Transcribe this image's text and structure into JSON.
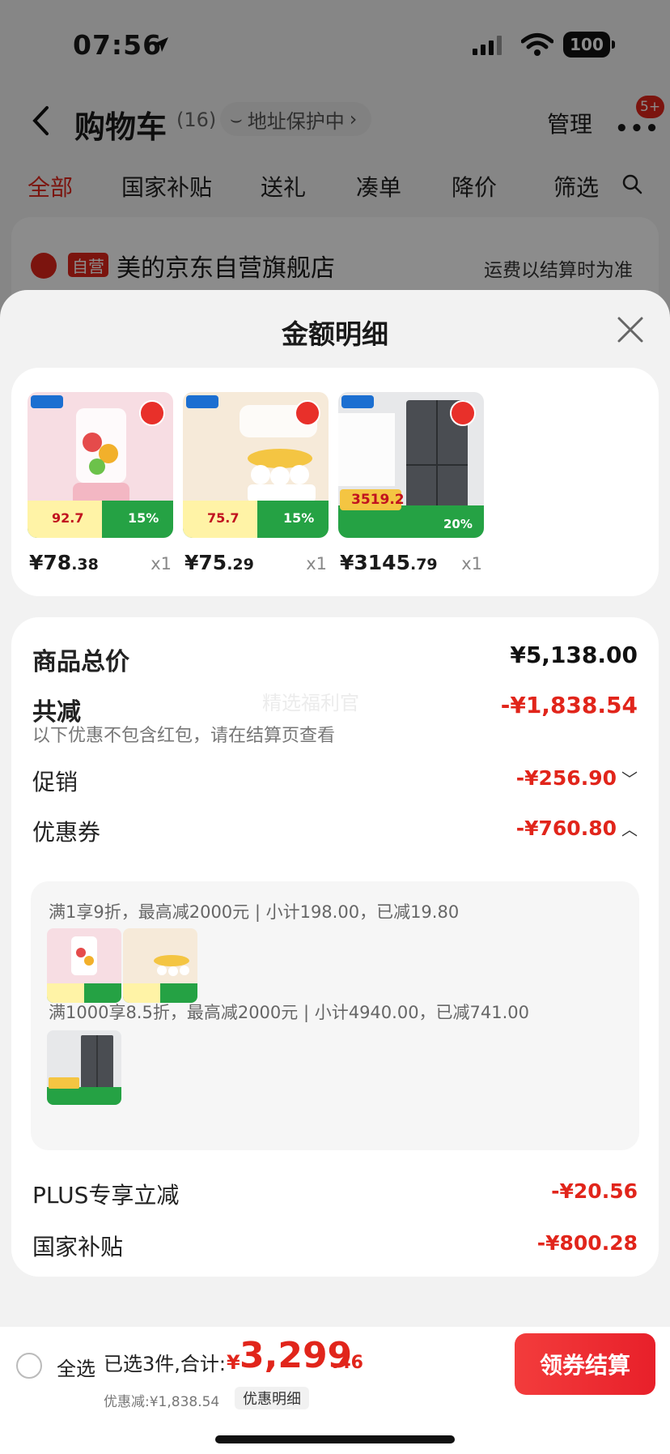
{
  "status_bar": {
    "time": "07:56",
    "battery": "100"
  },
  "nav": {
    "title": "购物车",
    "count": "(16)",
    "address_pill": "地址保护中",
    "manage": "管理",
    "badge": "5+"
  },
  "tabs": [
    "全部",
    "国家补贴",
    "送礼",
    "凑单",
    "降价",
    "筛选"
  ],
  "store": {
    "tag": "自营",
    "name": "美的京东自营旗舰店",
    "note": "运费以结算时为准"
  },
  "sheet": {
    "title": "金额明细",
    "products": [
      {
        "price_int": "¥78",
        "price_dec": ".38",
        "qty": "x1",
        "badge_price": "92.7",
        "subsidy": "15%"
      },
      {
        "price_int": "¥75",
        "price_dec": ".29",
        "qty": "x1",
        "badge_price": "75.7",
        "subsidy": "15%"
      },
      {
        "price_int": "¥3145",
        "price_dec": ".79",
        "qty": "x1",
        "badge_price": "3519.2",
        "subsidy": "20%"
      }
    ],
    "total_label": "商品总价",
    "total_value": "¥5,138.00",
    "reduce_label": "共减",
    "reduce_value": "-¥1,838.54",
    "reduce_note": "以下优惠不包含红包，请在结算页查看",
    "watermark": "精选福利官",
    "promo_label": "促销",
    "promo_value": "-¥256.90",
    "coupon_label": "优惠券",
    "coupon_value": "-¥760.80",
    "coupon_lines": [
      "满1享9折，最高减2000元 | 小计198.00，已减19.80",
      "满1000享8.5折，最高减2000元 | 小计4940.00，已减741.00"
    ],
    "plus_label": "PLUS专享立减",
    "plus_value": "-¥20.56",
    "gov_label": "国家补贴",
    "gov_value": "-¥800.28"
  },
  "bottom": {
    "select_all": "全选",
    "summary": "已选3件,合计:",
    "yen": "¥",
    "total_int": "3,299",
    "total_dec": ".46",
    "discount": "优惠减:¥1,838.54",
    "detail_btn": "优惠明细",
    "checkout": "领券结算"
  },
  "colors": {
    "accent": "#e1251b",
    "card": "#ffffff",
    "sheet_bg": "#f2f2f2"
  }
}
